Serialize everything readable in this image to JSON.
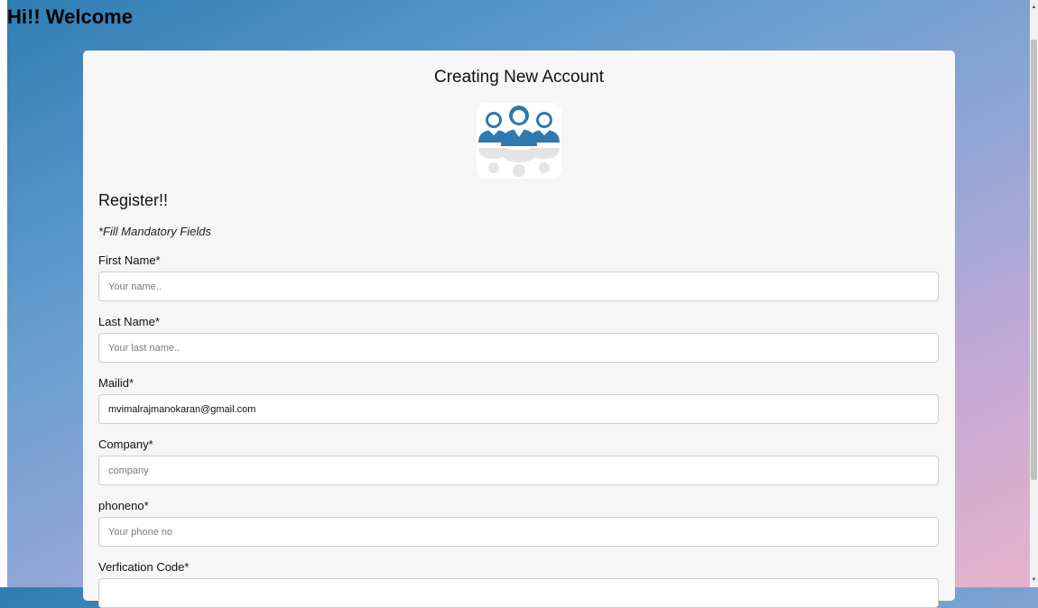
{
  "page": {
    "heading": "Hi!! Welcome"
  },
  "card": {
    "title": "Creating New Account",
    "logo_icon": "users-group-icon",
    "register_heading": "Register!!",
    "mandatory_note": "*Fill Mandatory Fields"
  },
  "form": {
    "first_name": {
      "label": "First Name*",
      "placeholder": "Your name..",
      "value": ""
    },
    "last_name": {
      "label": "Last Name*",
      "placeholder": "Your last name..",
      "value": ""
    },
    "mailid": {
      "label": "Mailid*",
      "placeholder": "",
      "value": "mvimalrajmanokaran@gmail.com"
    },
    "company": {
      "label": "Company*",
      "placeholder": "company",
      "value": ""
    },
    "phoneno": {
      "label": "phoneno*",
      "placeholder": "Your phone no",
      "value": ""
    },
    "verification_code": {
      "label": "Verfication Code*",
      "placeholder": "",
      "value": ""
    }
  },
  "colors": {
    "icon_blue": "#2f78b0",
    "card_bg": "#f6f6f6"
  }
}
